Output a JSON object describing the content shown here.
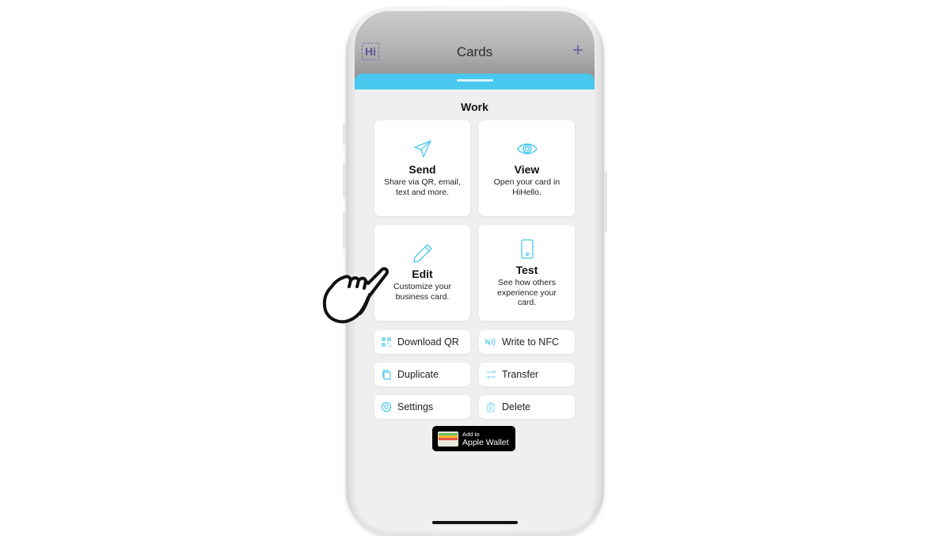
{
  "app": {
    "logo_text": "Hi",
    "title": "Cards",
    "add_label": "+"
  },
  "sheet": {
    "title": "Work",
    "accent_color": "#48c8ef"
  },
  "tiles": [
    {
      "label": "Send",
      "description": "Share via QR, email, text and more.",
      "icon": "paper-plane-icon"
    },
    {
      "label": "View",
      "description": "Open your card in HiHello.",
      "icon": "eye-icon"
    },
    {
      "label": "Edit",
      "description": "Customize your business card.",
      "icon": "pencil-icon"
    },
    {
      "label": "Test",
      "description": "See how others experience your card.",
      "icon": "phone-icon"
    }
  ],
  "actions": [
    {
      "label": "Download QR",
      "icon": "qr-code-icon"
    },
    {
      "label": "Write to NFC",
      "icon": "nfc-icon"
    },
    {
      "label": "Duplicate",
      "icon": "copy-icon"
    },
    {
      "label": "Transfer",
      "icon": "transfer-icon"
    },
    {
      "label": "Settings",
      "icon": "gear-icon"
    },
    {
      "label": "Delete",
      "icon": "trash-icon"
    }
  ],
  "wallet": {
    "small_text": "Add to",
    "big_text": "Apple Wallet"
  }
}
